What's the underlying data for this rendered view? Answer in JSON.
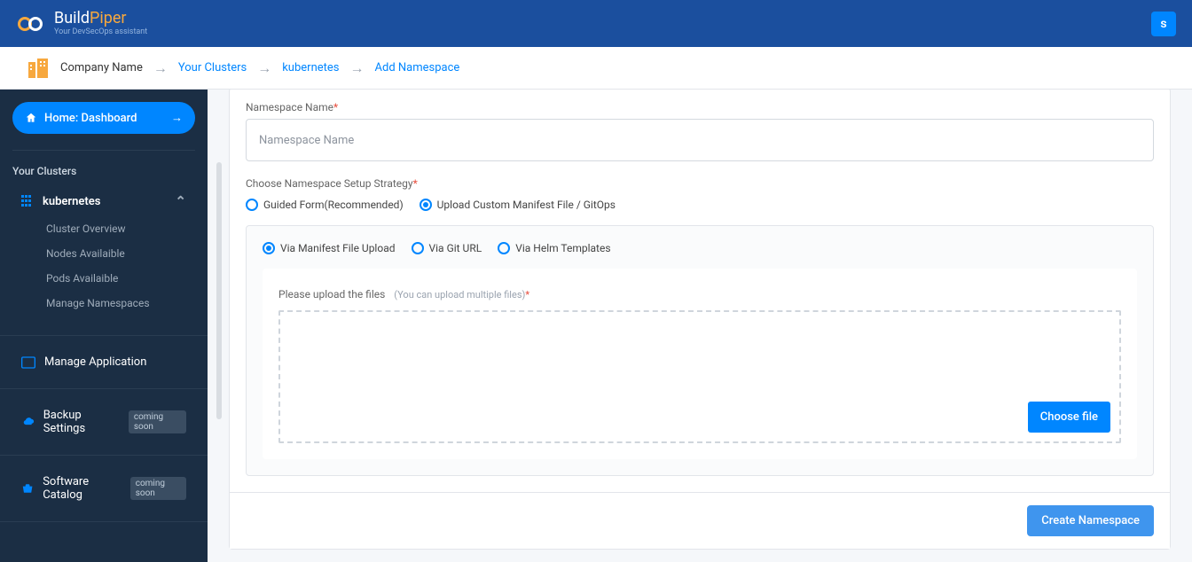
{
  "header": {
    "brand_main_a": "Build",
    "brand_main_b": "Piper",
    "brand_sub": "Your DevSecOps assistant",
    "user_initial": "s"
  },
  "breadcrumb": {
    "company": "Company Name",
    "items": [
      "Your Clusters",
      "kubernetes",
      "Add Namespace"
    ]
  },
  "sidebar": {
    "home": "Home: Dashboard",
    "section_clusters": "Your Clusters",
    "cluster_name": "kubernetes",
    "sub_items": [
      "Cluster Overview",
      "Nodes Availaible",
      "Pods Availaible",
      "Manage Namespaces"
    ],
    "manage_app": "Manage Application",
    "backup": "Backup Settings",
    "catalog": "Software Catalog",
    "coming_soon": "coming soon"
  },
  "form": {
    "ns_label": "Namespace Name",
    "ns_placeholder": "Namespace Name",
    "strategy_label": "Choose Namespace Setup Strategy",
    "opt_guided": "Guided Form(Recommended)",
    "opt_upload": "Upload Custom Manifest File / GitOps",
    "via_manifest": "Via Manifest File Upload",
    "via_git": "Via Git URL",
    "via_helm": "Via Helm Templates",
    "upload_label": "Please upload the files",
    "upload_hint": "(You can upload multiple files)",
    "choose_file": "Choose file",
    "create": "Create Namespace"
  }
}
